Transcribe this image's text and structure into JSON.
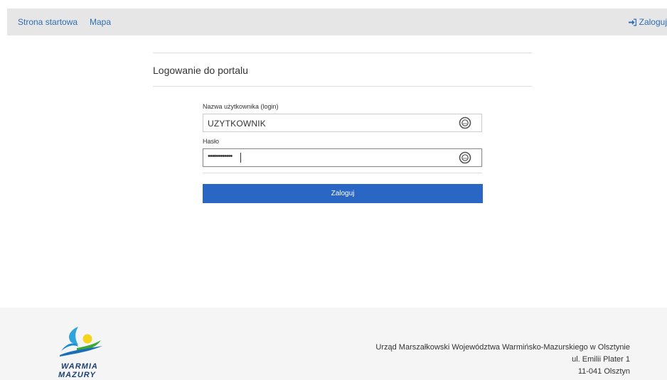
{
  "nav": {
    "home": "Strona startowa",
    "map": "Mapa",
    "login": "Zaloguj"
  },
  "form": {
    "title": "Logowanie do portalu",
    "username_label": "Nazwa użytkownika (login)",
    "username_value": "UZYTKOWNIK",
    "password_label": "Hasło",
    "password_value": "••••••••••••",
    "submit": "Zaloguj"
  },
  "footer": {
    "logo_line1": "WARMIA",
    "logo_line2": "MAZURY",
    "address_line1": "Urząd Marszałkowski Województwa Warmińsko-Mazurskiego w Olsztynie",
    "address_line2": "ul. Emilii Plater 1",
    "address_line3": "11-041 Olsztyn"
  },
  "colors": {
    "link": "#2f6fb3",
    "button": "#2a66c4",
    "topbar": "#e6e6e6",
    "footer": "#f5f5f5"
  },
  "icons": {
    "login": "sign-in-icon",
    "password_manager": "password-manager-icon"
  }
}
